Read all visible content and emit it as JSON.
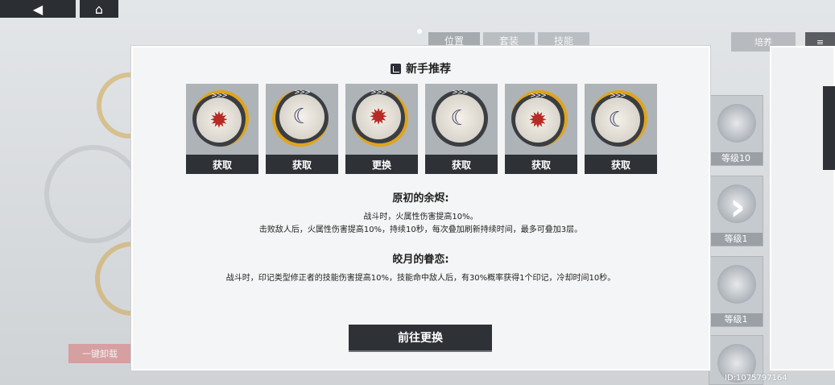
{
  "topbar": {
    "back_icon": "back-arrow-icon",
    "home_icon": "home-icon"
  },
  "background": {
    "tabs": [
      "位置",
      "套装",
      "技能"
    ],
    "cultivate_label": "培养",
    "levels": [
      "等级10",
      "等级1",
      "等级1"
    ],
    "unequip_label": "一键卸载",
    "uid": "ID:1075797164"
  },
  "panel": {
    "title": "新手推荐",
    "title_icon": "thumbs-up-icon",
    "slots": [
      {
        "icon": "flame-emblem-icon",
        "label": "获取"
      },
      {
        "icon": "crescent-bow-icon",
        "label": "获取"
      },
      {
        "icon": "flame-emblem-icon",
        "label": "更换"
      },
      {
        "icon": "crescent-bow-icon",
        "label": "获取"
      },
      {
        "icon": "flame-emblem-icon",
        "label": "获取"
      },
      {
        "icon": "crescent-bow-icon",
        "label": "获取"
      }
    ],
    "set1": {
      "name": "原初的余烬:",
      "line1": "战斗时，火属性伤害提高10%。",
      "line2": "击败敌人后，火属性伤害提高10%，持续10秒，每次叠加刷新持续时间，最多可叠加3层。"
    },
    "set2": {
      "name": "皎月的眷恋:",
      "line1": "战斗时，印记类型修正者的技能伤害提高10%，技能命中敌人后，有30%概率获得1个印记，冷却时间10秒。"
    },
    "go_button": "前往更换"
  },
  "colors": {
    "accent_gold": "#e0a41b",
    "button_dark": "#2e3136"
  }
}
